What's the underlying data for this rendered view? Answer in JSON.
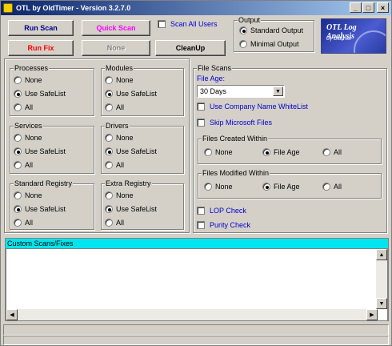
{
  "title": "OTL by OldTimer - Version 3.2.7.0",
  "titlebar": {
    "min": "_",
    "max": "□",
    "close": "×"
  },
  "buttons": {
    "run_scan": "Run Scan",
    "quick_scan": "Quick Scan",
    "run_fix": "Run Fix",
    "none": "None",
    "cleanup": "CleanUp"
  },
  "colors": {
    "run_scan": "#00008b",
    "quick_scan": "#ff00ff",
    "run_fix": "#ff0000",
    "none_disabled": "#808080",
    "custom_header": "#00e5ee",
    "link_blue": "#0000cc"
  },
  "scan_all_users": "Scan All Users",
  "output": {
    "caption": "Output",
    "standard": "Standard Output",
    "minimal": "Minimal Output"
  },
  "logo": {
    "line1": "OTL Log Analysis",
    "line2": "By Oldtimer"
  },
  "groups": {
    "processes": {
      "caption": "Processes",
      "opts": [
        "None",
        "Use SafeList",
        "All"
      ]
    },
    "modules": {
      "caption": "Modules",
      "opts": [
        "None",
        "Use SafeList",
        "All"
      ]
    },
    "services": {
      "caption": "Services",
      "opts": [
        "None",
        "Use SafeList",
        "All"
      ]
    },
    "drivers": {
      "caption": "Drivers",
      "opts": [
        "None",
        "Use SafeList",
        "All"
      ]
    },
    "std_registry": {
      "caption": "Standard Registry",
      "opts": [
        "None",
        "Use SafeList",
        "All"
      ]
    },
    "extra_registry": {
      "caption": "Extra Registry",
      "opts": [
        "None",
        "Use SafeList",
        "All"
      ]
    }
  },
  "file_scans": {
    "caption": "File Scans",
    "file_age_label": "File Age:",
    "file_age_value": "30 Days",
    "use_company": "Use Company Name WhiteList",
    "skip_ms": "Skip Microsoft Files",
    "created": {
      "caption": "Files Created Within",
      "opts": [
        "None",
        "File Age",
        "All"
      ]
    },
    "modified": {
      "caption": "Files Modified Within",
      "opts": [
        "None",
        "File Age",
        "All"
      ]
    },
    "lop_check": "LOP Check",
    "purity_check": "Purity Check"
  },
  "custom_scans": "Custom Scans/Fixes",
  "icons": {
    "app": "app-icon",
    "dropdown": "chevron-down-icon",
    "scroll_up": "arrow-up-icon",
    "scroll_down": "arrow-down-icon",
    "scroll_left": "arrow-left-icon",
    "scroll_right": "arrow-right-icon"
  }
}
